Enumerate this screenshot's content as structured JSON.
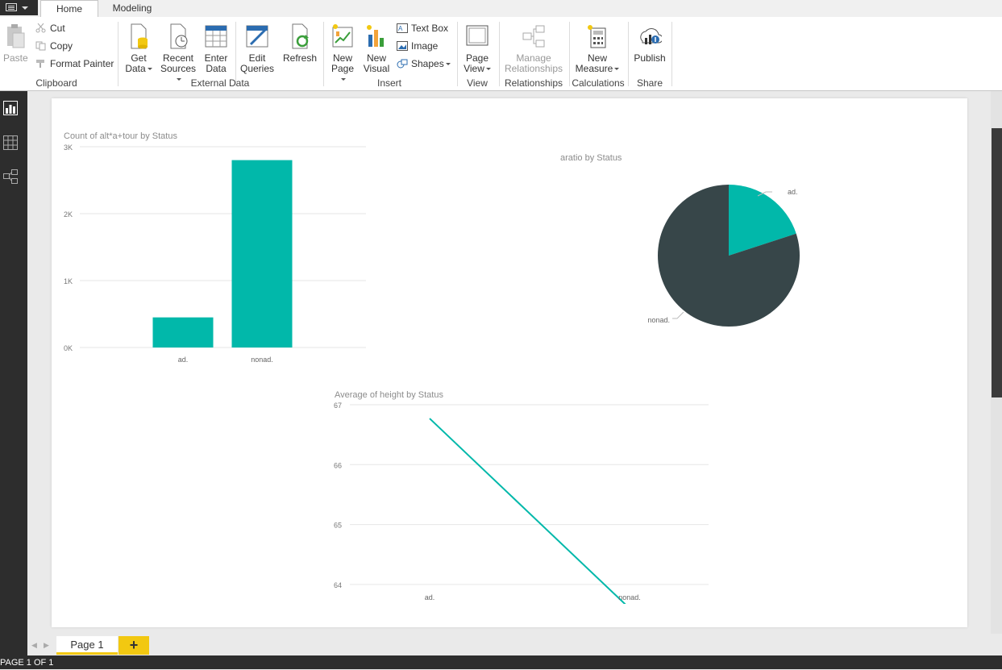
{
  "tabs": {
    "home": "Home",
    "modeling": "Modeling"
  },
  "ribbon": {
    "clipboard": {
      "paste": "Paste",
      "cut": "Cut",
      "copy": "Copy",
      "format_painter": "Format Painter",
      "group": "Clipboard"
    },
    "external": {
      "get_data": [
        "Get",
        "Data"
      ],
      "recent_sources": [
        "Recent",
        "Sources"
      ],
      "enter_data": [
        "Enter",
        "Data"
      ],
      "edit_queries": [
        "Edit",
        "Queries"
      ],
      "refresh": "Refresh",
      "group": "External Data"
    },
    "insert": {
      "new_page": [
        "New",
        "Page"
      ],
      "new_visual": [
        "New",
        "Visual"
      ],
      "text_box": "Text Box",
      "image": "Image",
      "shapes": "Shapes",
      "group": "Insert"
    },
    "view": {
      "page_view": [
        "Page",
        "View"
      ],
      "group": "View"
    },
    "relationships": {
      "manage": [
        "Manage",
        "Relationships"
      ],
      "group": "Relationships"
    },
    "calculations": {
      "new_measure": [
        "New",
        "Measure"
      ],
      "group": "Calculations"
    },
    "share": {
      "publish": "Publish",
      "group": "Share"
    }
  },
  "pages": {
    "tab": "Page 1",
    "add": "+",
    "status": "PAGE 1 OF 1"
  },
  "colors": {
    "teal": "#01b8aa",
    "dark": "#374649",
    "accent": "#f2c811"
  },
  "chart_data": [
    {
      "type": "bar",
      "title": "Count of alt*a+tour by Status",
      "categories": [
        "ad.",
        "nonad."
      ],
      "values": [
        450,
        2800
      ],
      "ylim": [
        0,
        3000
      ],
      "yticks": [
        0,
        1000,
        2000,
        3000
      ],
      "ytick_labels": [
        "0K",
        "1K",
        "2K",
        "3K"
      ],
      "grid": true
    },
    {
      "type": "pie",
      "title": "aratio by Status",
      "categories": [
        "ad.",
        "nonad."
      ],
      "values": [
        0.2,
        0.8
      ]
    },
    {
      "type": "line",
      "title": "Average of height by Status",
      "categories": [
        "ad.",
        "nonad."
      ],
      "values": [
        66.77,
        63.6
      ],
      "ylim": [
        63.5,
        67
      ],
      "yticks": [
        64,
        65,
        66,
        67
      ],
      "grid": true
    }
  ]
}
